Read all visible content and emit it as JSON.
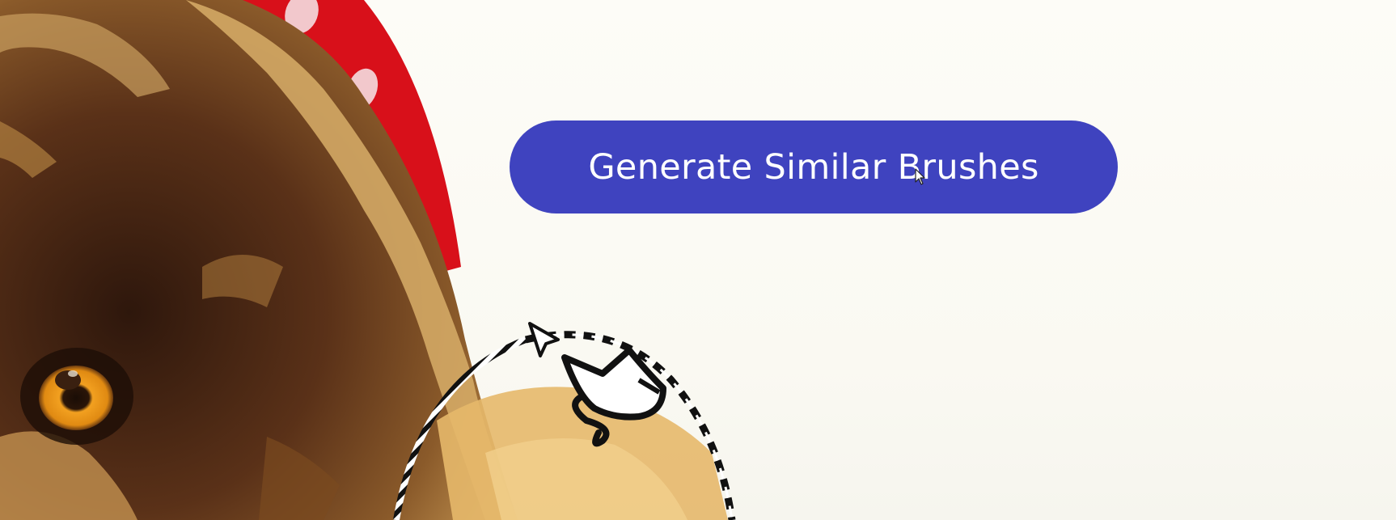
{
  "main": {
    "generate_button_label": "Generate Similar Brushes"
  },
  "colors": {
    "page_background": "#fbfaf4",
    "button_background": "#3f43bf",
    "button_text": "#ffffff",
    "red_shape": "#d8101a",
    "dog_fur_dark": "#3d2214",
    "dog_fur_light": "#e8c27a",
    "eye_amber": "#f2a020"
  },
  "icons": {
    "mouse_cursor": "arrow-cursor-icon",
    "brush_cursor": "brush-tool-cursor-icon"
  }
}
